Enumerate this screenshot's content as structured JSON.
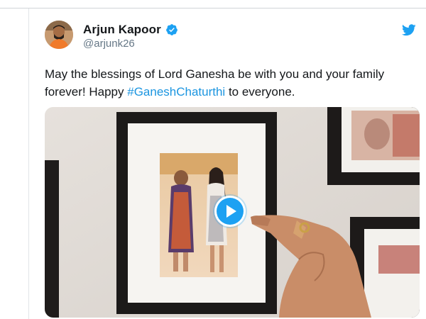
{
  "tweet": {
    "author_name": "Arjun Kapoor",
    "handle": "@arjunk26",
    "text_before": "May the blessings of Lord Ganesha be with you and your family forever! Happy ",
    "hashtag": "#GaneshChaturthi",
    "text_after": " to everyone."
  },
  "colors": {
    "twitter_blue": "#1da1f2",
    "hashtag": "#1b95e0",
    "handle_gray": "#657786"
  },
  "icons": {
    "verified": "verified-badge-icon",
    "twitter": "twitter-bird-icon",
    "play": "play-icon"
  }
}
